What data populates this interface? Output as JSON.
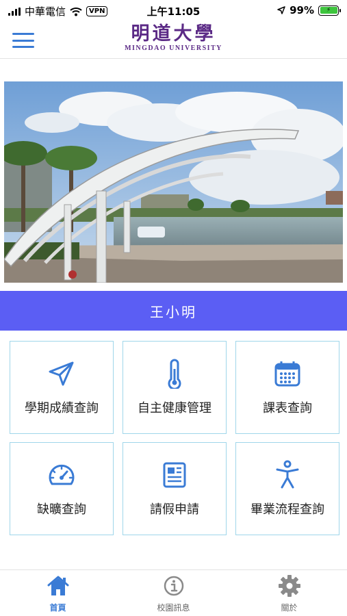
{
  "status_bar": {
    "carrier": "中華電信",
    "vpn": "VPN",
    "time": "上午11:05",
    "battery": "99%"
  },
  "header": {
    "logo_cn": "明道大學",
    "logo_en": "MINGDAO UNIVERSITY"
  },
  "user": {
    "name": "王小明"
  },
  "menu": {
    "items": [
      {
        "label": "學期成績查詢",
        "icon": "send-icon"
      },
      {
        "label": "自主健康管理",
        "icon": "thermometer-icon"
      },
      {
        "label": "課表查詢",
        "icon": "calendar-icon"
      },
      {
        "label": "缺曠查詢",
        "icon": "speedometer-icon"
      },
      {
        "label": "請假申請",
        "icon": "newspaper-icon"
      },
      {
        "label": "畢業流程查詢",
        "icon": "accessibility-icon"
      }
    ]
  },
  "tabs": [
    {
      "label": "首頁",
      "icon": "home-icon",
      "active": true
    },
    {
      "label": "校園訊息",
      "icon": "info-icon",
      "active": false
    },
    {
      "label": "關於",
      "icon": "gear-icon",
      "active": false
    }
  ],
  "colors": {
    "accent": "#3a7bd5",
    "name_bar": "#5b5ef4",
    "tile_border": "#9fd6ea",
    "logo": "#5b2a86",
    "icon_gray": "#8a8a8a"
  }
}
